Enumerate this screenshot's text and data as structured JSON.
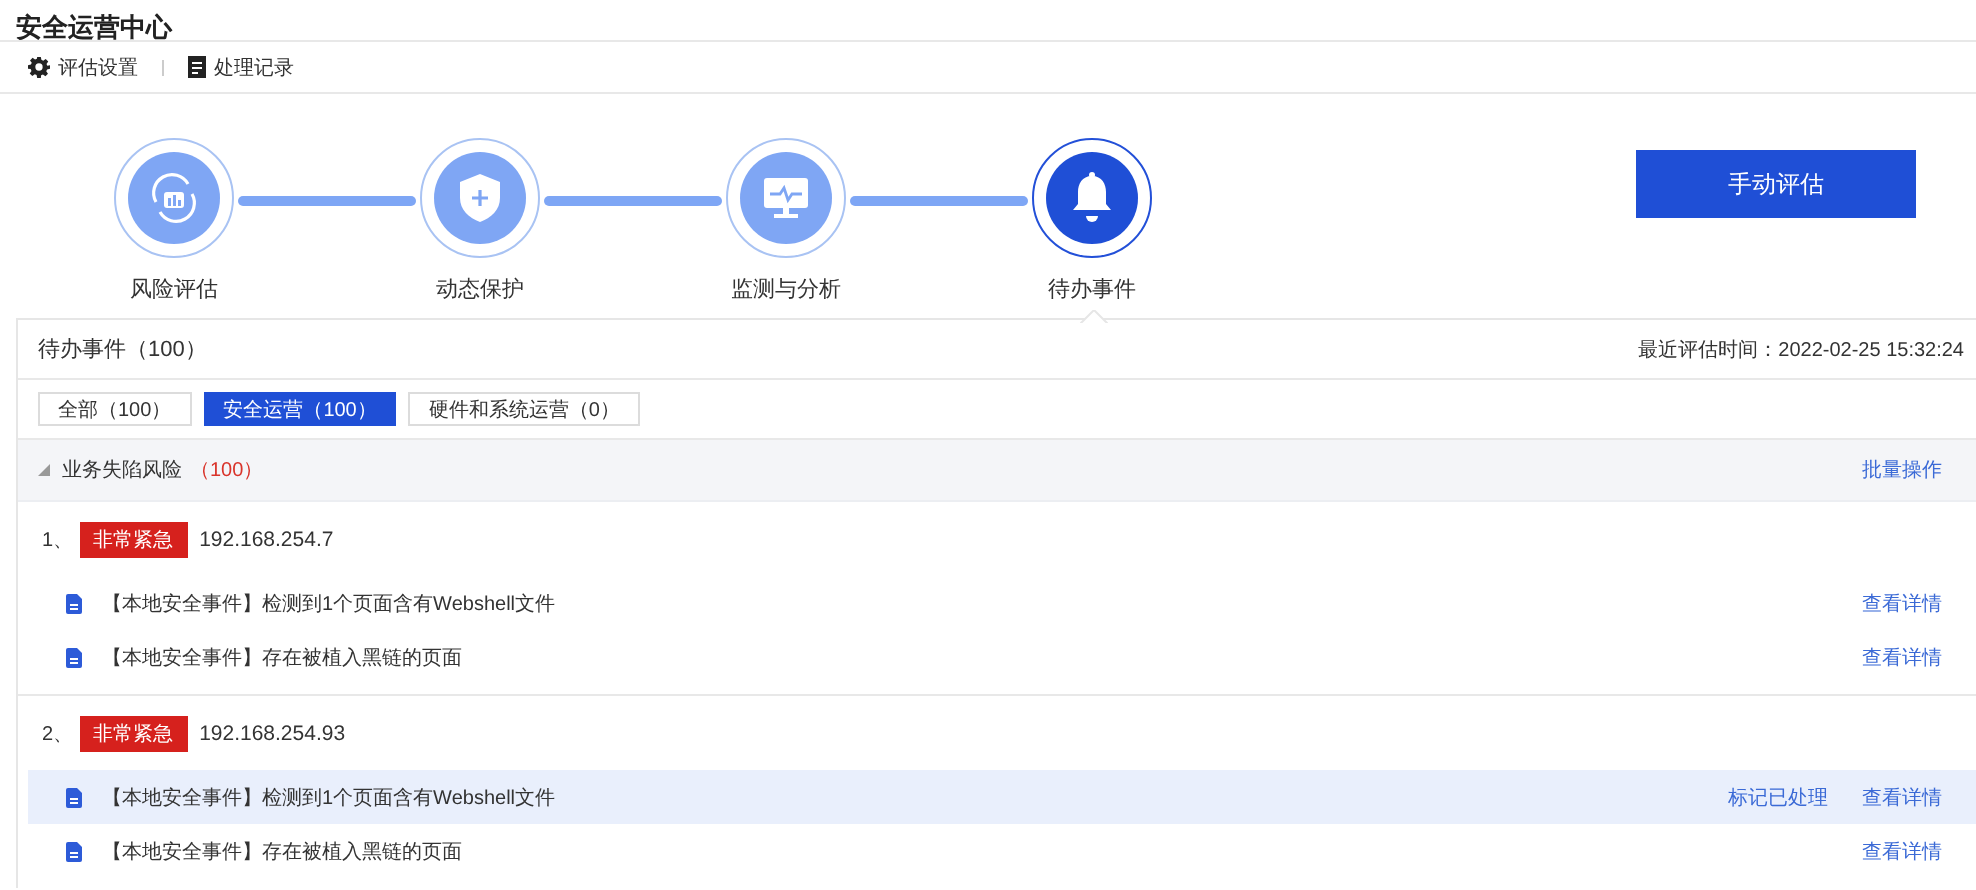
{
  "title": "安全运营中心",
  "toolbar": [
    {
      "kind": "gear",
      "label": "评估设置"
    },
    {
      "kind": "doc",
      "label": "处理记录"
    }
  ],
  "steps": [
    {
      "kind": "chart",
      "label": "风险评估",
      "selected": false
    },
    {
      "kind": "shield",
      "label": "动态保护",
      "selected": false
    },
    {
      "kind": "monitor",
      "label": "监测与分析",
      "selected": false
    },
    {
      "kind": "bell",
      "label": "待办事件",
      "selected": true
    }
  ],
  "manual_button": "手动评估",
  "panel": {
    "title": "待办事件（100）",
    "last_eval": "最近评估时间：2022-02-25 15:32:24",
    "filters": [
      {
        "label": "全部（100）",
        "selected": false
      },
      {
        "label": "安全运营（100）",
        "selected": true
      },
      {
        "label": "硬件和系统运营（0）",
        "selected": false
      }
    ],
    "group": {
      "label": "业务失陷风险",
      "count": "（100）",
      "expanded": true,
      "action": "批量操作"
    },
    "items": [
      {
        "number": "1、",
        "badge": "非常紧急",
        "ip": "192.168.254.7",
        "events": [
          {
            "text": "【本地安全事件】检测到1个页面含有Webshell文件",
            "highlighted": false,
            "actions": [
              "查看详情"
            ]
          },
          {
            "text": "【本地安全事件】存在被植入黑链的页面",
            "highlighted": false,
            "actions": [
              "查看详情"
            ]
          }
        ]
      },
      {
        "number": "2、",
        "badge": "非常紧急",
        "ip": "192.168.254.93",
        "events": [
          {
            "text": "【本地安全事件】检测到1个页面含有Webshell文件",
            "highlighted": true,
            "actions": [
              "标记已处理",
              "查看详情"
            ]
          },
          {
            "text": "【本地安全事件】存在被植入黑链的页面",
            "highlighted": false,
            "actions": [
              "查看详情"
            ]
          }
        ]
      }
    ]
  }
}
